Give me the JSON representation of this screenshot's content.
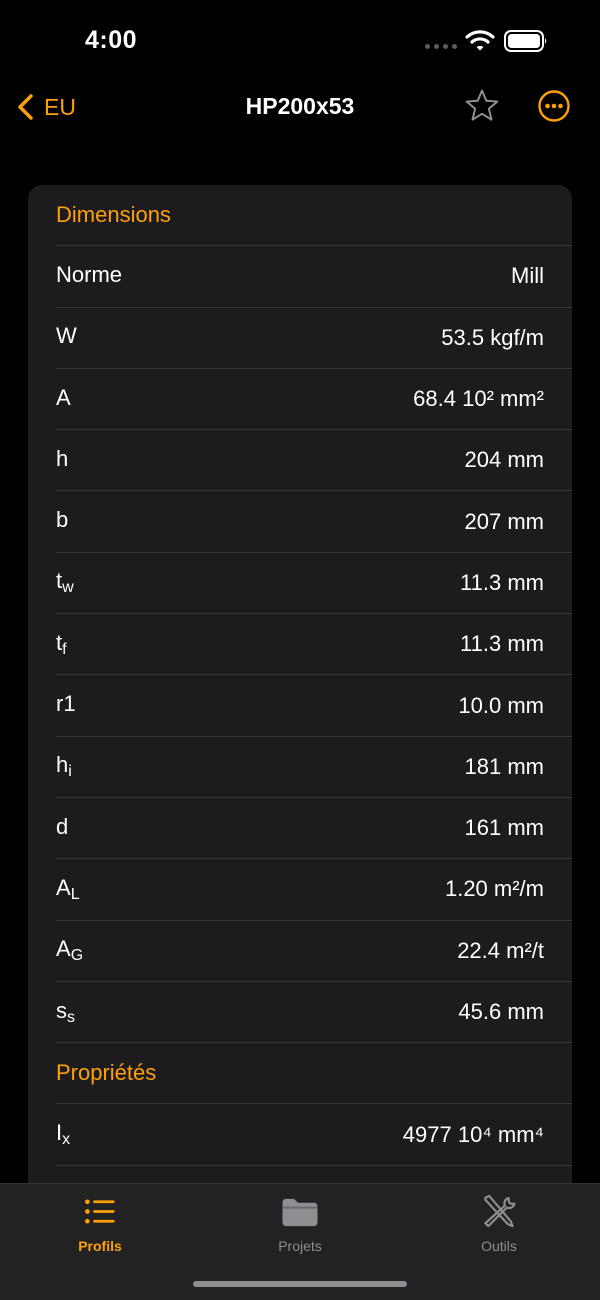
{
  "status_bar": {
    "time": "4:00"
  },
  "nav": {
    "back_label": "EU",
    "title": "HP200x53"
  },
  "sections": [
    {
      "header": "Dimensions",
      "rows": [
        {
          "label": "Norme",
          "sub": "",
          "value": "Mill"
        },
        {
          "label": "W",
          "sub": "",
          "value": "53.5 kgf/m"
        },
        {
          "label": "A",
          "sub": "",
          "value": "68.4 10² mm²"
        },
        {
          "label": "h",
          "sub": "",
          "value": "204 mm"
        },
        {
          "label": "b",
          "sub": "",
          "value": "207 mm"
        },
        {
          "label": "t",
          "sub": "w",
          "value": "11.3 mm"
        },
        {
          "label": "t",
          "sub": "f",
          "value": "11.3 mm"
        },
        {
          "label": "r1",
          "sub": "",
          "value": "10.0 mm"
        },
        {
          "label": "h",
          "sub": "i",
          "value": "181 mm"
        },
        {
          "label": "d",
          "sub": "",
          "value": "161 mm"
        },
        {
          "label": "A",
          "sub": "L",
          "value": "1.20 m²/m"
        },
        {
          "label": "A",
          "sub": "G",
          "value": "22.4 m²/t"
        },
        {
          "label": "s",
          "sub": "s",
          "value": "45.6 mm"
        }
      ]
    },
    {
      "header": "Propriétés",
      "rows": [
        {
          "label": "I",
          "sub": "x",
          "value": "4977 10⁴ mm⁴"
        }
      ]
    }
  ],
  "tab_bar": {
    "tabs": [
      {
        "label": "Profils",
        "icon": "list-icon",
        "active": true
      },
      {
        "label": "Projets",
        "icon": "folder-icon",
        "active": false
      },
      {
        "label": "Outils",
        "icon": "tools-icon",
        "active": false
      }
    ]
  },
  "colors": {
    "accent": "#ff9f0a",
    "card": "#1c1c1e",
    "background": "#000000",
    "inactive": "#8e8e93"
  }
}
